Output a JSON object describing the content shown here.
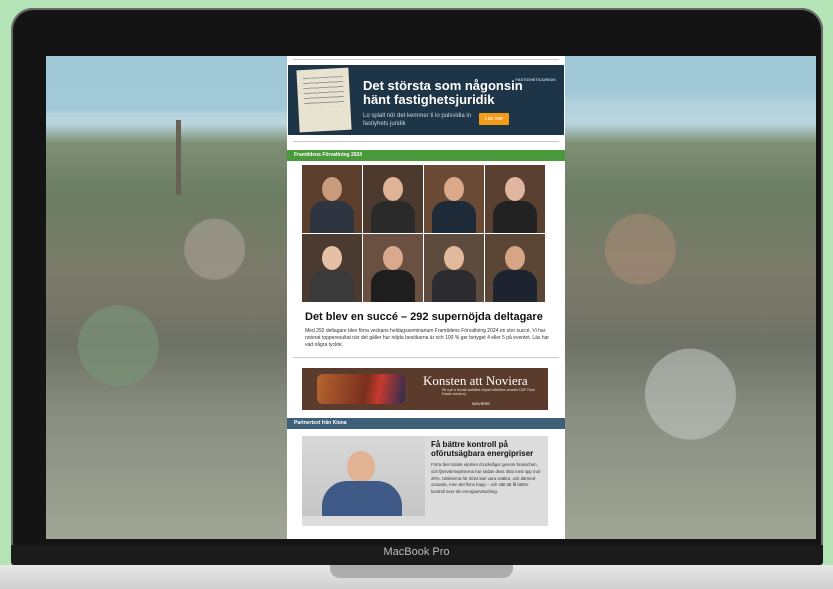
{
  "device": {
    "model": "MacBook Pro"
  },
  "ad_top": {
    "headline": "Det största som någonsin hänt fastighetsjuridik",
    "sub": "Lo splall nör det kemmer ti lo pulsvidia in fastiyhets juridik",
    "button": "Läs mer",
    "logo": "FASTIGHETSJURIDIK"
  },
  "section1": {
    "label": "Framtidens Förvaltning 2024"
  },
  "article": {
    "title": "Det blev en succé – 292 supernöjda deltagare",
    "body": "Med 292 deltagare blev förra veckans heldagsseminarium Framtidens Förvaltning 2024 en stor succé. Vi har noterat topperesultat när det gäller hur nöjda besökarna är och 100 % ger betyget 4 eller 5 på eventet. Läs har vad några tyckte."
  },
  "photos": [
    {
      "skin": "#c99a7c",
      "shirt": "#2f3540",
      "bg": "#5b3e2c"
    },
    {
      "skin": "#dfb395",
      "shirt": "#2a2a2a",
      "bg": "#4d3a2e"
    },
    {
      "skin": "#d9a98a",
      "shirt": "#1f2a38",
      "bg": "#6b4b35"
    },
    {
      "skin": "#e0b6a0",
      "shirt": "#222",
      "bg": "#5a4030"
    },
    {
      "skin": "#e6c0a6",
      "shirt": "#3a3a3a",
      "bg": "#4a3a30"
    },
    {
      "skin": "#d8a98e",
      "shirt": "#1e1e1e",
      "bg": "#6a5040"
    },
    {
      "skin": "#e3b99c",
      "shirt": "#2b2b30",
      "bg": "#5d4c3e"
    },
    {
      "skin": "#d5a585",
      "shirt": "#1d2430",
      "bg": "#5b4636"
    }
  ],
  "ad_mid": {
    "title": "Konsten att Noviera",
    "sub": "Ett nytt a förvalt stabilitet nöjvari effektiva smarter DDF Real Estate Advisory",
    "logo": "NOVIERE"
  },
  "section2": {
    "label": "Partnertext från Kiona"
  },
  "partner": {
    "title": "Få bättre kontroll på oförutsägbara energipriser",
    "body": "Förra året sände elpriset chockvågor genom branschen, och fjärrvärmepriserna har sedan dess ökat med upp mot 20%. Utsikterna för 2024 kan vara osäkra, och därmed oroande, men det finns hopp – och sätt att få bättre kontroll över din energianvändning."
  }
}
